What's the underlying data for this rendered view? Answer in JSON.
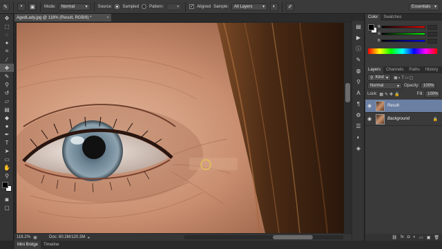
{
  "options_bar": {
    "mode_label": "Mode:",
    "mode_value": "Normal",
    "source_label": "Source:",
    "source_sampled": "Sampled",
    "source_pattern": "Pattern:",
    "aligned_label": "Aligned",
    "sample_label": "Sample:",
    "sample_value": "All Layers",
    "workspace_value": "Essentials"
  },
  "document": {
    "tab_title": "AgedLady.jpg @ 118% (Result, RGB/8) *",
    "zoom": "118.2%",
    "doc_size": "Doc: 60.2M/120.3M"
  },
  "bottom_tabs": [
    "Mini Bridge",
    "Timeline"
  ],
  "color_panel": {
    "tabs": [
      "Color",
      "Swatches"
    ],
    "foreground": "#000000",
    "background": "#ffffff"
  },
  "layers_panel": {
    "tabs": [
      "Layers",
      "Channels",
      "Paths",
      "History"
    ],
    "filter_label": "Kind",
    "blend_mode": "Normal",
    "opacity_label": "Opacity:",
    "opacity_value": "100%",
    "lock_label": "Lock:",
    "fill_label": "Fill:",
    "fill_value": "100%",
    "layers": [
      {
        "name": "Result",
        "selected": true
      },
      {
        "name": "Background",
        "selected": false
      }
    ],
    "footer_icons": [
      "link-icon",
      "fx-icon",
      "mask-icon",
      "adjustment-icon",
      "folder-icon",
      "new-layer-icon",
      "trash-icon"
    ]
  }
}
